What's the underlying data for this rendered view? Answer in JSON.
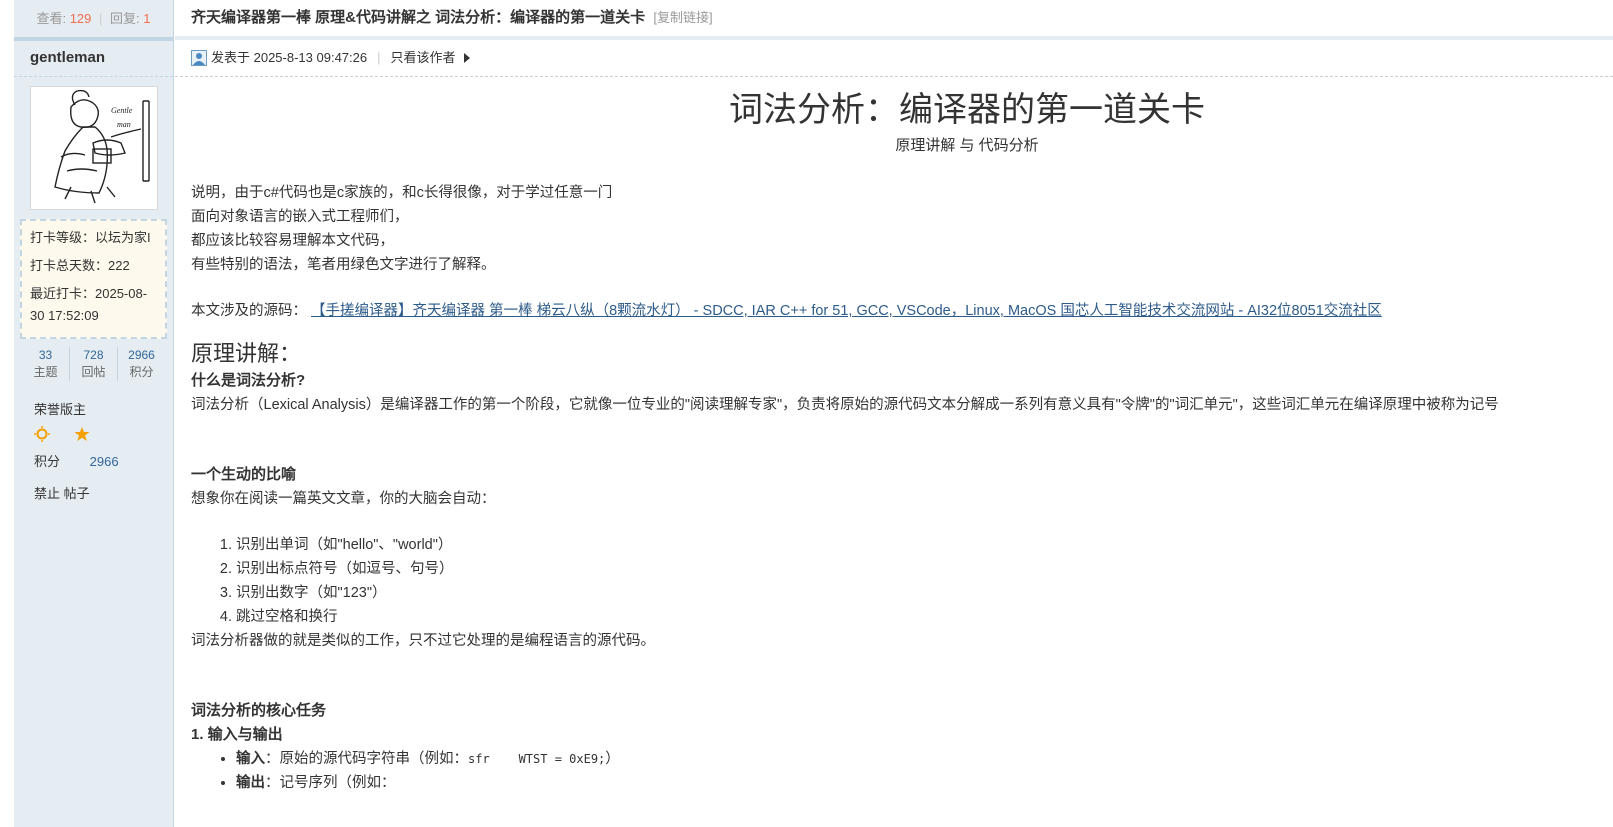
{
  "thread": {
    "views_label": "查看:",
    "views": "129",
    "replies_label": "回复:",
    "replies": "1",
    "title": "齐天编译器第一棒 原理&代码讲解之 词法分析：编译器的第一道关卡",
    "copy_link": "[复制链接]"
  },
  "author": {
    "name": "gentleman",
    "checkin_level": "打卡等级：以坛为家I",
    "checkin_days": "打卡总天数：222",
    "checkin_last_line1": "最近打卡：2025-08-",
    "checkin_last_line2": "30 17:52:09",
    "topics_value": "33",
    "topics_label": "主题",
    "posts_value": "728",
    "posts_label": "回帖",
    "points_value": "2966",
    "points_label": "积分",
    "honor": "荣誉版主",
    "points_row_label": "积分",
    "points_row_value": "2966",
    "ban_text": "禁止 帖子",
    "medals": [
      "sun-icon",
      "moon-icon",
      "star-icon"
    ],
    "avatar_text_1": "Gentle",
    "avatar_text_2": "man"
  },
  "post": {
    "posted_at": "发表于 2025-8-13 09:47:26",
    "author_only": "只看该作者",
    "headline": "词法分析：编译器的第一道关卡",
    "subtitle": "原理讲解 与 代码分析",
    "intro": [
      "说明，由于c#代码也是c家族的，和c长得很像，对于学过任意一门",
      "面向对象语言的嵌入式工程师们，",
      "都应该比较容易理解本文代码，",
      "有些特别的语法，笔者用绿色文字进行了解释。"
    ],
    "source_label": "本文涉及的源码：",
    "source_link": "【手搓编译器】齐天编译器 第一棒 梯云八纵（8颗流水灯） - SDCC, IAR C++ for 51, GCC, VSCode，Linux, MacOS 国芯人工智能技术交流网站 - AI32位8051交流社区",
    "section_principle": "原理讲解：",
    "what_is": "什么是词法分析?",
    "what_is_body": "词法分析（Lexical Analysis）是编译器工作的第一个阶段，它就像一位专业的\"阅读理解专家\"，负责将原始的源代码文本分解成一系列有意义具有\"令牌\"的\"词汇单元\"，这些词汇单元在编译原理中被称为记号",
    "analogy_title": "一个生动的比喻",
    "analogy_intro": "想象你在阅读一篇英文文章，你的大脑会自动：",
    "steps": [
      "识别出单词（如\"hello\"、\"world\"）",
      "识别出标点符号（如逗号、句号）",
      "识别出数字（如\"123\"）",
      "跳过空格和换行"
    ],
    "analogy_outro": "词法分析器做的就是类似的工作，只不过它处理的是编程语言的源代码。",
    "core_tasks": "词法分析的核心任务",
    "io_title": "1. 输入与输出",
    "input_label": "输入",
    "input_text": "：原始的源代码字符串（例如：",
    "input_code": "sfr    WTST = 0xE9;",
    "input_tail": "）",
    "output_label": "输出",
    "output_text": "：记号序列（例如："
  },
  "colors": {
    "sidebar_bg": "#e5edf2",
    "border": "#c2d5e3",
    "accent_number": "#f26c4f",
    "link": "#2d5b8a",
    "checkin_bg": "#fdf9ec"
  }
}
